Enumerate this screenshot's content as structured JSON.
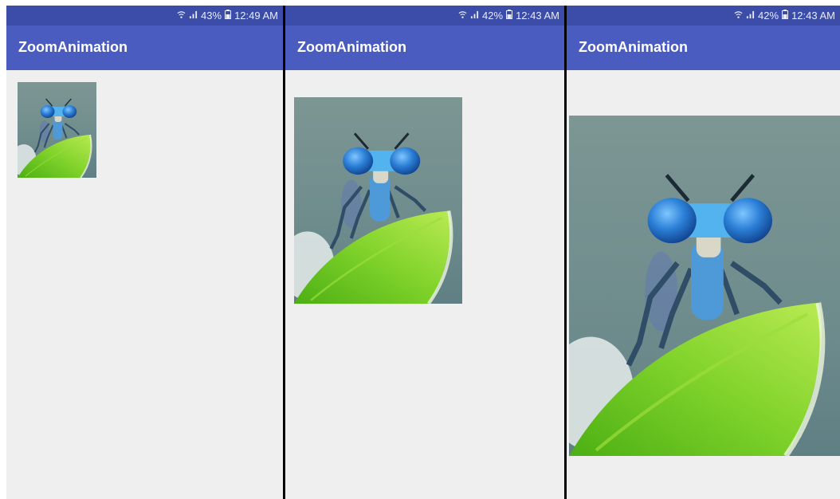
{
  "screens": [
    {
      "status": {
        "battery": "43%",
        "time": "12:49 AM"
      },
      "app_title": "ZoomAnimation"
    },
    {
      "status": {
        "battery": "42%",
        "time": "12:43 AM"
      },
      "app_title": "ZoomAnimation"
    },
    {
      "status": {
        "battery": "42%",
        "time": "12:43 AM"
      },
      "app_title": "ZoomAnimation"
    }
  ],
  "colors": {
    "status_bar": "#3c4da9",
    "app_bar": "#4a5cc0",
    "background": "#efefef"
  },
  "image_subject": "dragonfly-on-leaf-photo"
}
